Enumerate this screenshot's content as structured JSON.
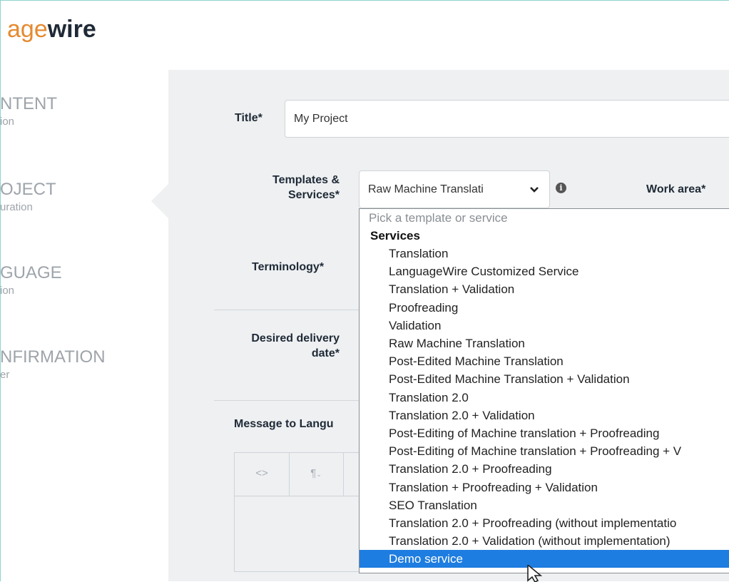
{
  "brand": {
    "logo_light": "age",
    "logo_bold": "wire"
  },
  "sidebar": {
    "steps": [
      {
        "title": "NTENT",
        "subtitle": "ion"
      },
      {
        "title": "OJECT",
        "subtitle": "uration"
      },
      {
        "title": "GUAGE",
        "subtitle": "ion"
      },
      {
        "title": "NFIRMATION",
        "subtitle": "er"
      }
    ]
  },
  "form": {
    "title_label": "Title*",
    "title_value": "My Project",
    "templates_label_line1": "Templates &",
    "templates_label_line2": "Services*",
    "templates_selected": "Raw Machine Translati",
    "work_area_label": "Work area*",
    "terminology_label": "Terminology*",
    "delivery_label_line1": "Desired delivery",
    "delivery_label_line2": "date*",
    "message_label": "Message to Langu"
  },
  "editor": {
    "btn_code": "<>",
    "btn_para": "¶"
  },
  "dropdown": {
    "placeholder": "Pick a template or service",
    "group": "Services",
    "items": [
      "Translation",
      "LanguageWire Customized Service",
      "Translation + Validation",
      "Proofreading",
      "Validation",
      "Raw Machine Translation",
      "Post-Edited Machine Translation",
      "Post-Edited Machine Translation + Validation",
      "Translation 2.0",
      "Translation 2.0 + Validation",
      "Post-Editing of Machine translation + Proofreading",
      "Post-Editing of Machine translation + Proofreading + V",
      "Translation 2.0 + Proofreading",
      "Translation + Proofreading + Validation",
      "SEO Translation",
      "Translation 2.0 + Proofreading (without implementatio",
      "Translation 2.0 + Validation (without implementation)",
      "Demo service"
    ],
    "selected_index": 17,
    "highlight_color": "#1e7de0"
  }
}
